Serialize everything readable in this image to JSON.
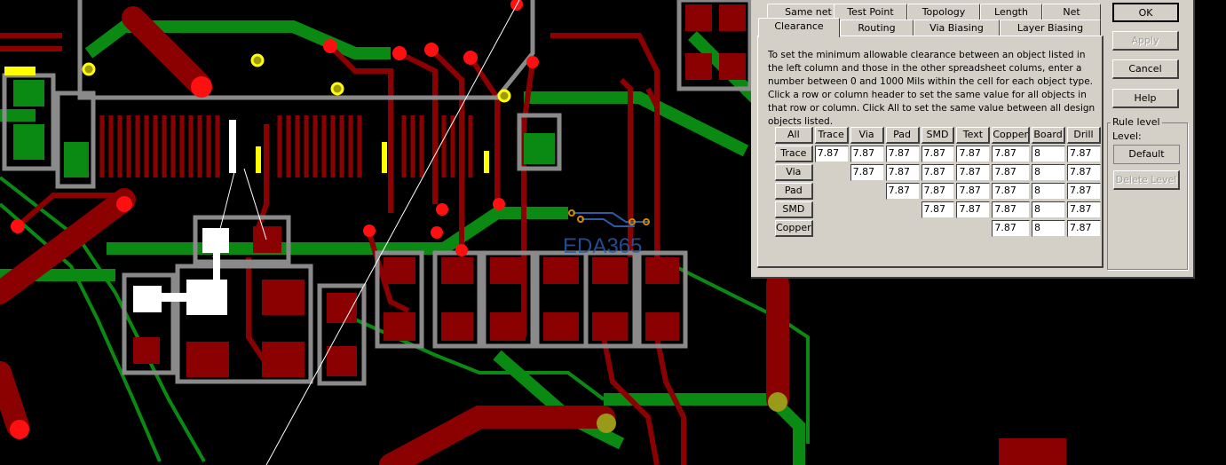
{
  "watermark": "EDA365",
  "dialog": {
    "tabs_row1": [
      "Same net",
      "Test Point",
      "Topology",
      "Length",
      "Net"
    ],
    "tabs_row2": [
      "Clearance",
      "Routing",
      "Via Biasing",
      "Layer Biasing"
    ],
    "active_tab": "Clearance",
    "description": "To set the minimum allowable clearance between an object listed in the left column and those in the other spreadsheet colums, enter a number between 0 and 1000 Mils within the cell for each object type. Click a row or column header to set the same value for all objects in that row or column. Click All to set the same value between all design objects listed.",
    "buttons": {
      "ok": "OK",
      "apply": "Apply",
      "cancel": "Cancel",
      "help": "Help"
    },
    "rule_level": {
      "group": "Rule level",
      "label": "Level:",
      "value": "Default",
      "delete": "Delete Level"
    },
    "table": {
      "all": "All",
      "columns": [
        "Trace",
        "Via",
        "Pad",
        "SMD",
        "Text",
        "Copper",
        "Board",
        "Drill"
      ],
      "rows": [
        {
          "name": "Trace",
          "values": [
            "7.87",
            "7.87",
            "7.87",
            "7.87",
            "7.87",
            "7.87",
            "8",
            "7.87"
          ]
        },
        {
          "name": "Via",
          "values": [
            null,
            "7.87",
            "7.87",
            "7.87",
            "7.87",
            "7.87",
            "8",
            "7.87"
          ]
        },
        {
          "name": "Pad",
          "values": [
            null,
            null,
            "7.87",
            "7.87",
            "7.87",
            "7.87",
            "8",
            "7.87"
          ]
        },
        {
          "name": "SMD",
          "values": [
            null,
            null,
            null,
            "7.87",
            "7.87",
            "7.87",
            "8",
            "7.87"
          ]
        },
        {
          "name": "Copper",
          "values": [
            null,
            null,
            null,
            null,
            null,
            "7.87",
            "8",
            "7.87"
          ]
        }
      ]
    }
  }
}
